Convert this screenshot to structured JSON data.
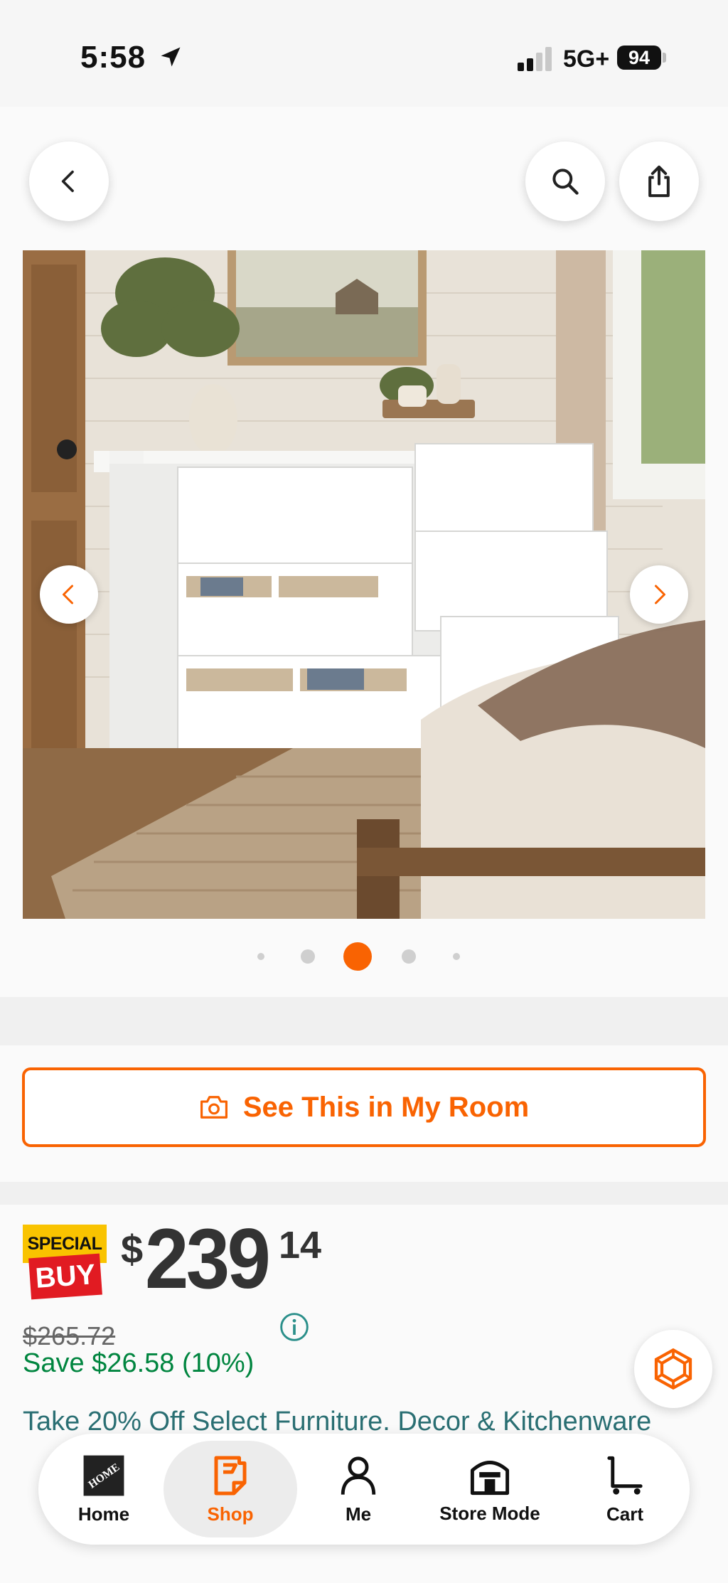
{
  "status_bar": {
    "time": "5:58",
    "network": "5G+",
    "battery": "94"
  },
  "header": {
    "back_icon": "chevron-left-icon",
    "search_icon": "search-icon",
    "share_icon": "share-icon"
  },
  "gallery": {
    "image_description_icon": "product-photo",
    "prev_icon": "chevron-left-icon",
    "next_icon": "chevron-right-icon",
    "page_count": 5,
    "active_index": 2
  },
  "room_button": {
    "label": "See This in My Room",
    "icon": "camera-icon"
  },
  "pricing": {
    "badge_top": "SPECIAL",
    "badge_bottom": "BUY",
    "currency": "$",
    "dollars": "239",
    "cents": "14",
    "was_price": "$265.72",
    "save_text": "Save $26.58 (10%)",
    "promo_text": "Take 20% Off Select Furniture. Decor & Kitchenware"
  },
  "tab_bar": {
    "tabs": [
      {
        "label": "Home",
        "icon": "home-depot-logo-icon"
      },
      {
        "label": "Shop",
        "icon": "shop-tag-icon"
      },
      {
        "label": "Me",
        "icon": "person-icon"
      },
      {
        "label": "Store Mode",
        "icon": "store-icon"
      },
      {
        "label": "Cart",
        "icon": "cart-icon"
      }
    ],
    "active": "Shop"
  },
  "colors": {
    "brand_orange": "#f96302",
    "save_green": "#00853f",
    "promo_teal": "#2a6f73",
    "special_yellow": "#f9c300",
    "special_red": "#e11b22"
  }
}
